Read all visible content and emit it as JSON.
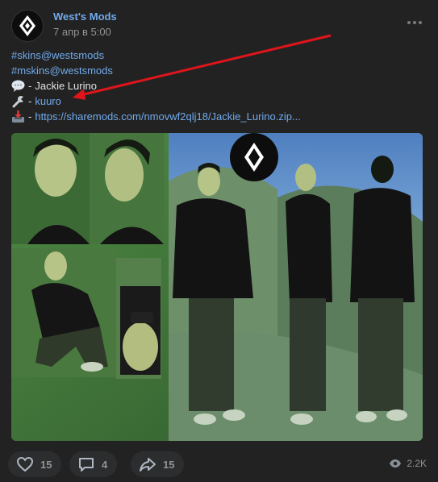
{
  "post": {
    "author": "West's Mods",
    "date": "7 апр в 5:00",
    "lines": [
      {
        "icon": "",
        "prefix": "",
        "text": "#skins@westsmods",
        "is_link": true
      },
      {
        "icon": "",
        "prefix": "",
        "text": "#mskins@westsmods",
        "is_link": true
      },
      {
        "icon": "speech-bubble-icon",
        "prefix": "- ",
        "text": "Jackie Lurino",
        "is_link": false
      },
      {
        "icon": "wrench-icon",
        "prefix": "- ",
        "text": "kuuro",
        "is_link": true
      },
      {
        "icon": "inbox-tray-icon",
        "prefix": "- ",
        "text": "https://sharemods.com/nmovwf2qlj18/Jackie_Lurino.zip...",
        "is_link": true
      }
    ]
  },
  "footer": {
    "likes": "15",
    "comments": "4",
    "shares": "15",
    "views": "2.2K"
  },
  "colors": {
    "link": "#71aaeb",
    "background": "#222222",
    "arrow": "#e0151b"
  }
}
